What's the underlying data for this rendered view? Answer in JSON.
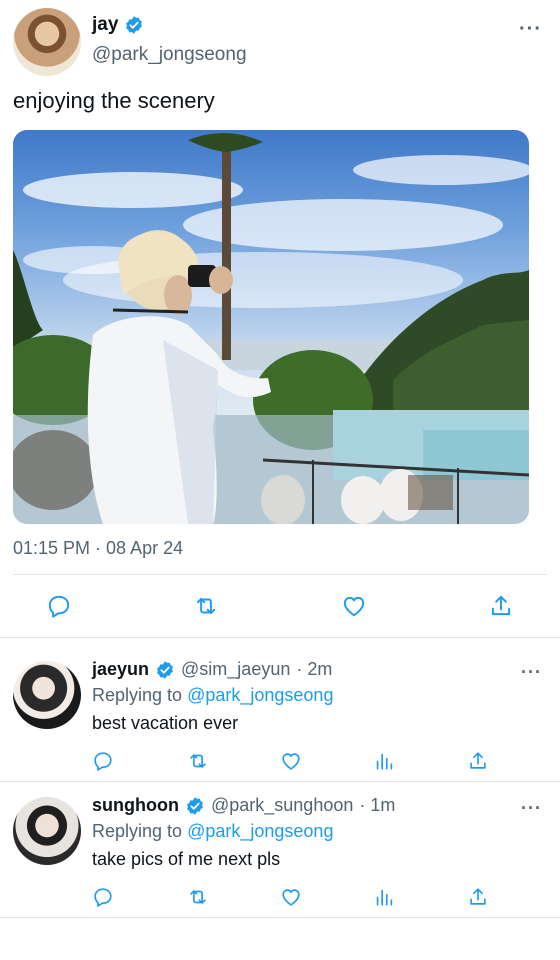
{
  "tweet": {
    "display_name": "jay",
    "handle": "@park_jongseong",
    "text": "enjoying the scenery",
    "timestamp": "01:15 PM · 08 Apr 24",
    "more": "···"
  },
  "icons": {
    "reply": "reply-icon",
    "retweet": "retweet-icon",
    "like": "heart-icon",
    "share": "share-icon",
    "analytics": "analytics-icon",
    "verified": "verified-badge-icon"
  },
  "colors": {
    "link": "#1d9bf0",
    "secondary_text": "#536471",
    "verified": "#1d9bf0"
  },
  "replies": [
    {
      "display_name": "jaeyun",
      "handle": "@sim_jaeyun",
      "time": "· 2m",
      "replying_prefix": "Replying to",
      "replying_to": "@park_jongseong",
      "text": "best vacation ever",
      "more": "···"
    },
    {
      "display_name": "sunghoon",
      "handle": "@park_sunghoon",
      "time": "· 1m",
      "replying_prefix": "Replying to",
      "replying_to": "@park_jongseong",
      "text": "take pics of me next pls",
      "more": "···"
    }
  ]
}
